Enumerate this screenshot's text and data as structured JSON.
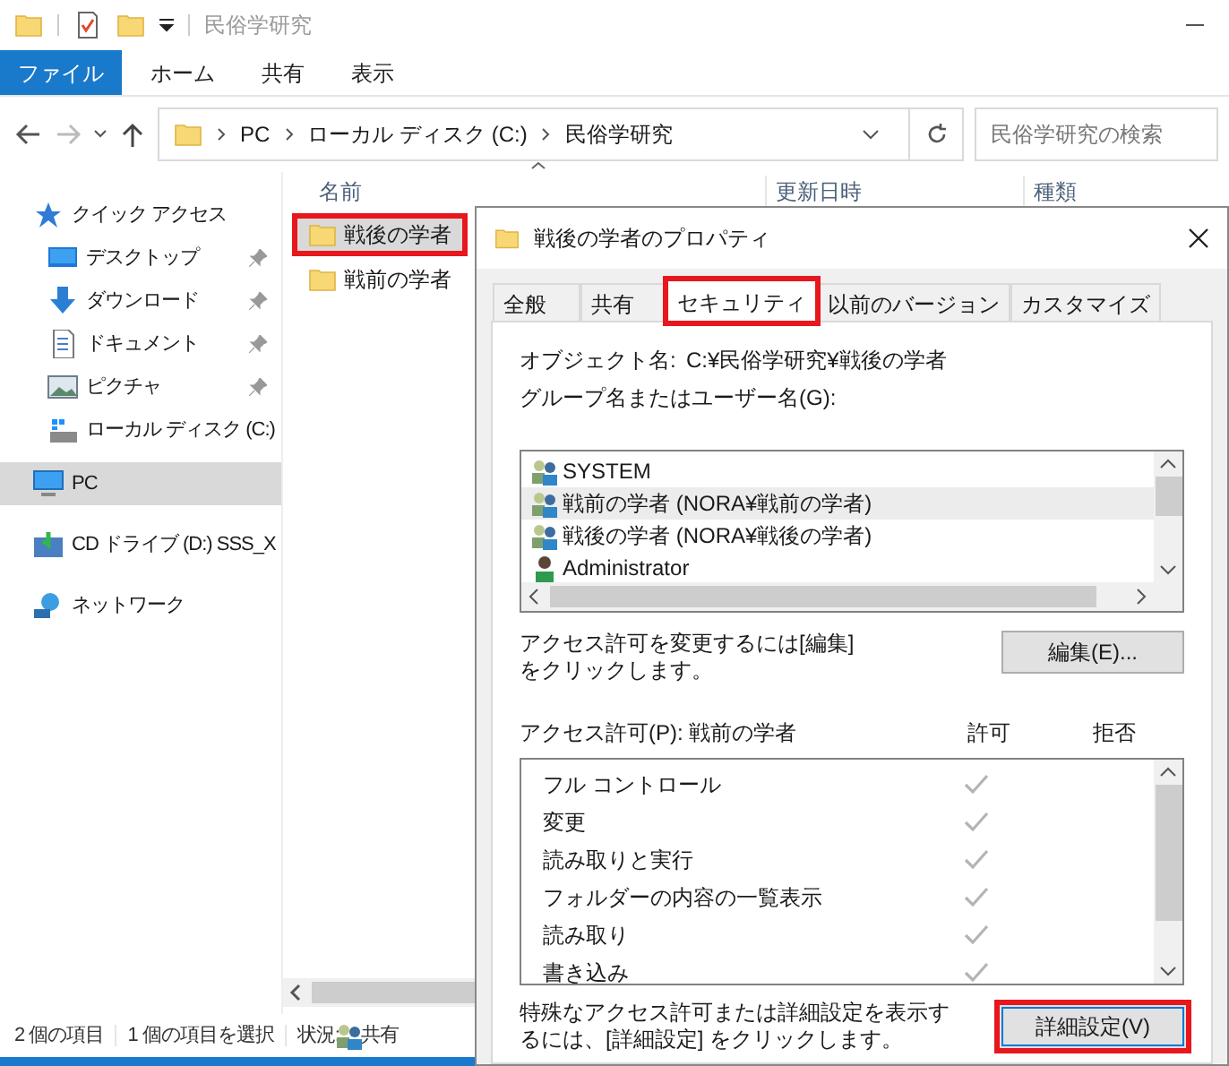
{
  "window": {
    "title": "民俗学研究"
  },
  "ribbon_tabs": [
    {
      "label": "ファイル",
      "selected": true
    },
    {
      "label": "ホーム",
      "selected": false
    },
    {
      "label": "共有",
      "selected": false
    },
    {
      "label": "表示",
      "selected": false
    }
  ],
  "address_bar": {
    "back_disabled": false,
    "forward_disabled": true,
    "path": [
      "PC",
      "ローカル ディスク (C:)",
      "民俗学研究"
    ]
  },
  "search": {
    "placeholder": "民俗学研究の検索"
  },
  "sidebar": {
    "items": [
      {
        "label": "クイック アクセス",
        "kind": "star",
        "selected": false,
        "children": [
          {
            "label": "デスクトップ",
            "kind": "desktop",
            "pinned": true,
            "selected": false
          },
          {
            "label": "ダウンロード",
            "kind": "download",
            "pinned": true,
            "selected": false
          },
          {
            "label": "ドキュメント",
            "kind": "document",
            "pinned": true,
            "selected": false
          },
          {
            "label": "ピクチャ",
            "kind": "picture",
            "pinned": true,
            "selected": false
          },
          {
            "label": "ローカル ディスク (C:)",
            "kind": "disk",
            "pinned": false,
            "selected": false
          }
        ]
      },
      {
        "label": "PC",
        "kind": "pc",
        "selected": true
      },
      {
        "label": "CD ドライブ (D:) SSS_X",
        "kind": "cd",
        "selected": false
      },
      {
        "label": "ネットワーク",
        "kind": "network",
        "selected": false
      }
    ]
  },
  "file_list": {
    "columns": [
      "名前",
      "更新日時",
      "種類"
    ],
    "rows": [
      {
        "name": "戦後の学者",
        "selected": true,
        "highlighted": true
      },
      {
        "name": "戦前の学者",
        "selected": false,
        "highlighted": false
      }
    ]
  },
  "status_bar": {
    "count": "2 個の項目",
    "selection": "1 個の項目を選択",
    "state_label": "状況:",
    "state_value": "共有"
  },
  "dialog": {
    "title": "戦後の学者のプロパティ",
    "tabs": [
      {
        "label": "全般",
        "selected": false,
        "highlighted": false
      },
      {
        "label": "共有",
        "selected": false,
        "highlighted": false
      },
      {
        "label": "セキュリティ",
        "selected": true,
        "highlighted": true
      },
      {
        "label": "以前のバージョン",
        "selected": false,
        "highlighted": false
      },
      {
        "label": "カスタマイズ",
        "selected": false,
        "highlighted": false
      }
    ],
    "object_label": "オブジェクト名:",
    "object_value": "C:¥民俗学研究¥戦後の学者",
    "groups_label": "グループ名またはユーザー名(G):",
    "users": [
      {
        "name": "SYSTEM",
        "kind": "group",
        "selected": false
      },
      {
        "name": "戦前の学者 (NORA¥戦前の学者)",
        "kind": "group",
        "selected": true
      },
      {
        "name": "戦後の学者 (NORA¥戦後の学者)",
        "kind": "group",
        "selected": false
      },
      {
        "name": "Administrator",
        "kind": "user",
        "selected": false
      }
    ],
    "edit_hint": "アクセス許可を変更するには[編集]をクリックします。",
    "edit_button": "編集(E)...",
    "permissions_label": "アクセス許可(P): 戦前の学者",
    "allow_label": "許可",
    "deny_label": "拒否",
    "permissions": [
      {
        "label": "フル コントロール",
        "allow": true,
        "deny": false
      },
      {
        "label": "変更",
        "allow": true,
        "deny": false
      },
      {
        "label": "読み取りと実行",
        "allow": true,
        "deny": false
      },
      {
        "label": "フォルダーの内容の一覧表示",
        "allow": true,
        "deny": false
      },
      {
        "label": "読み取り",
        "allow": true,
        "deny": false
      },
      {
        "label": "書き込み",
        "allow": true,
        "deny": false
      }
    ],
    "advanced_hint": "特殊なアクセス許可または詳細設定を表示するには、[詳細設定] をクリックします。",
    "advanced_button": {
      "label": "詳細設定(V)",
      "highlighted": true
    }
  }
}
